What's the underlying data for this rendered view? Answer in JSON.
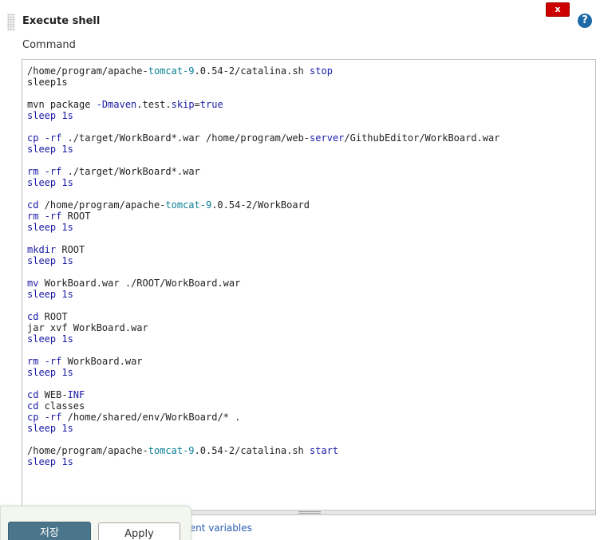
{
  "step": {
    "title": "Execute shell",
    "delete_label": "x",
    "help_label": "?",
    "command_label": "Command"
  },
  "editor": {
    "lines": [
      [
        {
          "t": "/home/program/apache-"
        },
        {
          "t": "tomcat-9",
          "c": "ver"
        },
        {
          "t": ".0.54-2/catalina.sh "
        },
        {
          "t": "stop",
          "c": "kw"
        }
      ],
      [
        {
          "t": "sleep1s"
        }
      ],
      [],
      [
        {
          "t": "mvn package "
        },
        {
          "t": "-Dmaven",
          "c": "opt"
        },
        {
          "t": ".test."
        },
        {
          "t": "skip",
          "c": "opt"
        },
        {
          "t": "="
        },
        {
          "t": "true",
          "c": "kw"
        }
      ],
      [
        {
          "t": "sleep 1s",
          "c": "kw"
        }
      ],
      [],
      [
        {
          "t": "cp",
          "c": "kw"
        },
        {
          "t": " "
        },
        {
          "t": "-rf",
          "c": "opt"
        },
        {
          "t": " ./target/WorkBoard*.war /home/program/web-"
        },
        {
          "t": "server",
          "c": "kw"
        },
        {
          "t": "/GithubEditor/WorkBoard.war"
        }
      ],
      [
        {
          "t": "sleep 1s",
          "c": "kw"
        }
      ],
      [],
      [
        {
          "t": "rm",
          "c": "kw"
        },
        {
          "t": " "
        },
        {
          "t": "-rf",
          "c": "opt"
        },
        {
          "t": " ./target/WorkBoard*.war"
        }
      ],
      [
        {
          "t": "sleep 1s",
          "c": "kw"
        }
      ],
      [],
      [
        {
          "t": "cd",
          "c": "kw"
        },
        {
          "t": " /home/program/apache-"
        },
        {
          "t": "tomcat-9",
          "c": "ver"
        },
        {
          "t": ".0.54-2/WorkBoard"
        }
      ],
      [
        {
          "t": "rm",
          "c": "kw"
        },
        {
          "t": " "
        },
        {
          "t": "-rf",
          "c": "opt"
        },
        {
          "t": " ROOT"
        }
      ],
      [
        {
          "t": "sleep 1s",
          "c": "kw"
        }
      ],
      [],
      [
        {
          "t": "mkdir",
          "c": "kw"
        },
        {
          "t": " ROOT"
        }
      ],
      [
        {
          "t": "sleep 1s",
          "c": "kw"
        }
      ],
      [],
      [
        {
          "t": "mv",
          "c": "kw"
        },
        {
          "t": " WorkBoard.war ./ROOT/WorkBoard.war"
        }
      ],
      [
        {
          "t": "sleep 1s",
          "c": "kw"
        }
      ],
      [],
      [
        {
          "t": "cd",
          "c": "kw"
        },
        {
          "t": " ROOT"
        }
      ],
      [
        {
          "t": "jar xvf WorkBoard.war"
        }
      ],
      [
        {
          "t": "sleep 1s",
          "c": "kw"
        }
      ],
      [],
      [
        {
          "t": "rm",
          "c": "kw"
        },
        {
          "t": " "
        },
        {
          "t": "-rf",
          "c": "opt"
        },
        {
          "t": " WorkBoard.war"
        }
      ],
      [
        {
          "t": "sleep 1s",
          "c": "kw"
        }
      ],
      [],
      [
        {
          "t": "cd",
          "c": "kw"
        },
        {
          "t": " WEB-"
        },
        {
          "t": "INF",
          "c": "kw"
        }
      ],
      [
        {
          "t": "cd",
          "c": "kw"
        },
        {
          "t": " classes"
        }
      ],
      [
        {
          "t": "cp",
          "c": "kw"
        },
        {
          "t": " "
        },
        {
          "t": "-rf",
          "c": "opt"
        },
        {
          "t": " /home/shared/env/WorkBoard/* ."
        }
      ],
      [
        {
          "t": "sleep 1s",
          "c": "kw"
        }
      ],
      [],
      [
        {
          "t": "/home/program/apache-"
        },
        {
          "t": "tomcat-9",
          "c": "ver"
        },
        {
          "t": ".0.54-2/catalina.sh "
        },
        {
          "t": "start",
          "c": "kw"
        }
      ],
      [
        {
          "t": "sleep 1s",
          "c": "kw"
        }
      ]
    ]
  },
  "footer": {
    "env_link_text": "ment variables",
    "save_label": "저장",
    "apply_label": "Apply"
  },
  "colors": {
    "keyword": "#1a1aa6",
    "version": "#0a7f96",
    "delete_button": "#cc0000",
    "help_icon": "#1c69a8",
    "save_button": "#4b758b",
    "link": "#2a5db0"
  }
}
